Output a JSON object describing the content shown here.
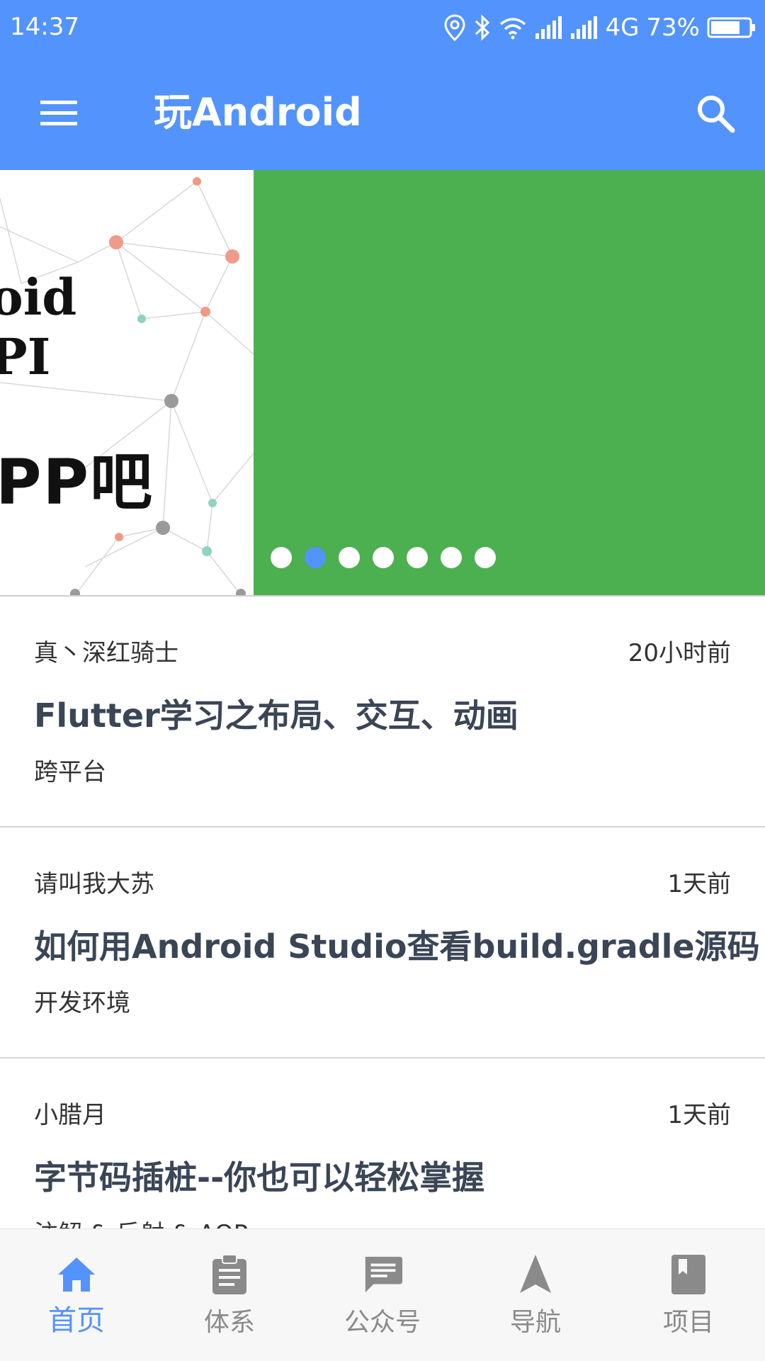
{
  "status_bar": {
    "time": "14:37",
    "network": "4G",
    "battery": "73%",
    "icons": [
      "location-icon",
      "bluetooth-icon",
      "wifi-icon",
      "signal-icon",
      "signal-4g-icon",
      "battery-icon"
    ]
  },
  "app_bar": {
    "title": "玩Android",
    "menu_icon": "menu-icon",
    "search_icon": "search-icon",
    "color": "#5393fd"
  },
  "banner": {
    "left_text_lines": [
      "oid",
      "PI",
      "PP吧"
    ],
    "right_color": "#4caf50",
    "dot_count": 7,
    "active_dot": 2
  },
  "articles": [
    {
      "author": "真丶深红骑士",
      "time": "20小时前",
      "title": "Flutter学习之布局、交互、动画",
      "tag": "跨平台"
    },
    {
      "author": "请叫我大苏",
      "time": "1天前",
      "title": "如何用Android Studio查看build.gradle源码",
      "tag": "开发环境"
    },
    {
      "author": "小腊月",
      "time": "1天前",
      "title": "字节码插桩--你也可以轻松掌握",
      "tag": "注解 & 反射 & AOP"
    }
  ],
  "bottom_nav": {
    "items": [
      {
        "label": "首页",
        "icon": "home-icon",
        "active": true
      },
      {
        "label": "体系",
        "icon": "clipboard-icon",
        "active": false
      },
      {
        "label": "公众号",
        "icon": "message-icon",
        "active": false
      },
      {
        "label": "导航",
        "icon": "navigation-arrow-icon",
        "active": false
      },
      {
        "label": "项目",
        "icon": "bookmark-book-icon",
        "active": false
      }
    ],
    "active_color": "#5393fd",
    "inactive_color": "#8a8a8a"
  }
}
